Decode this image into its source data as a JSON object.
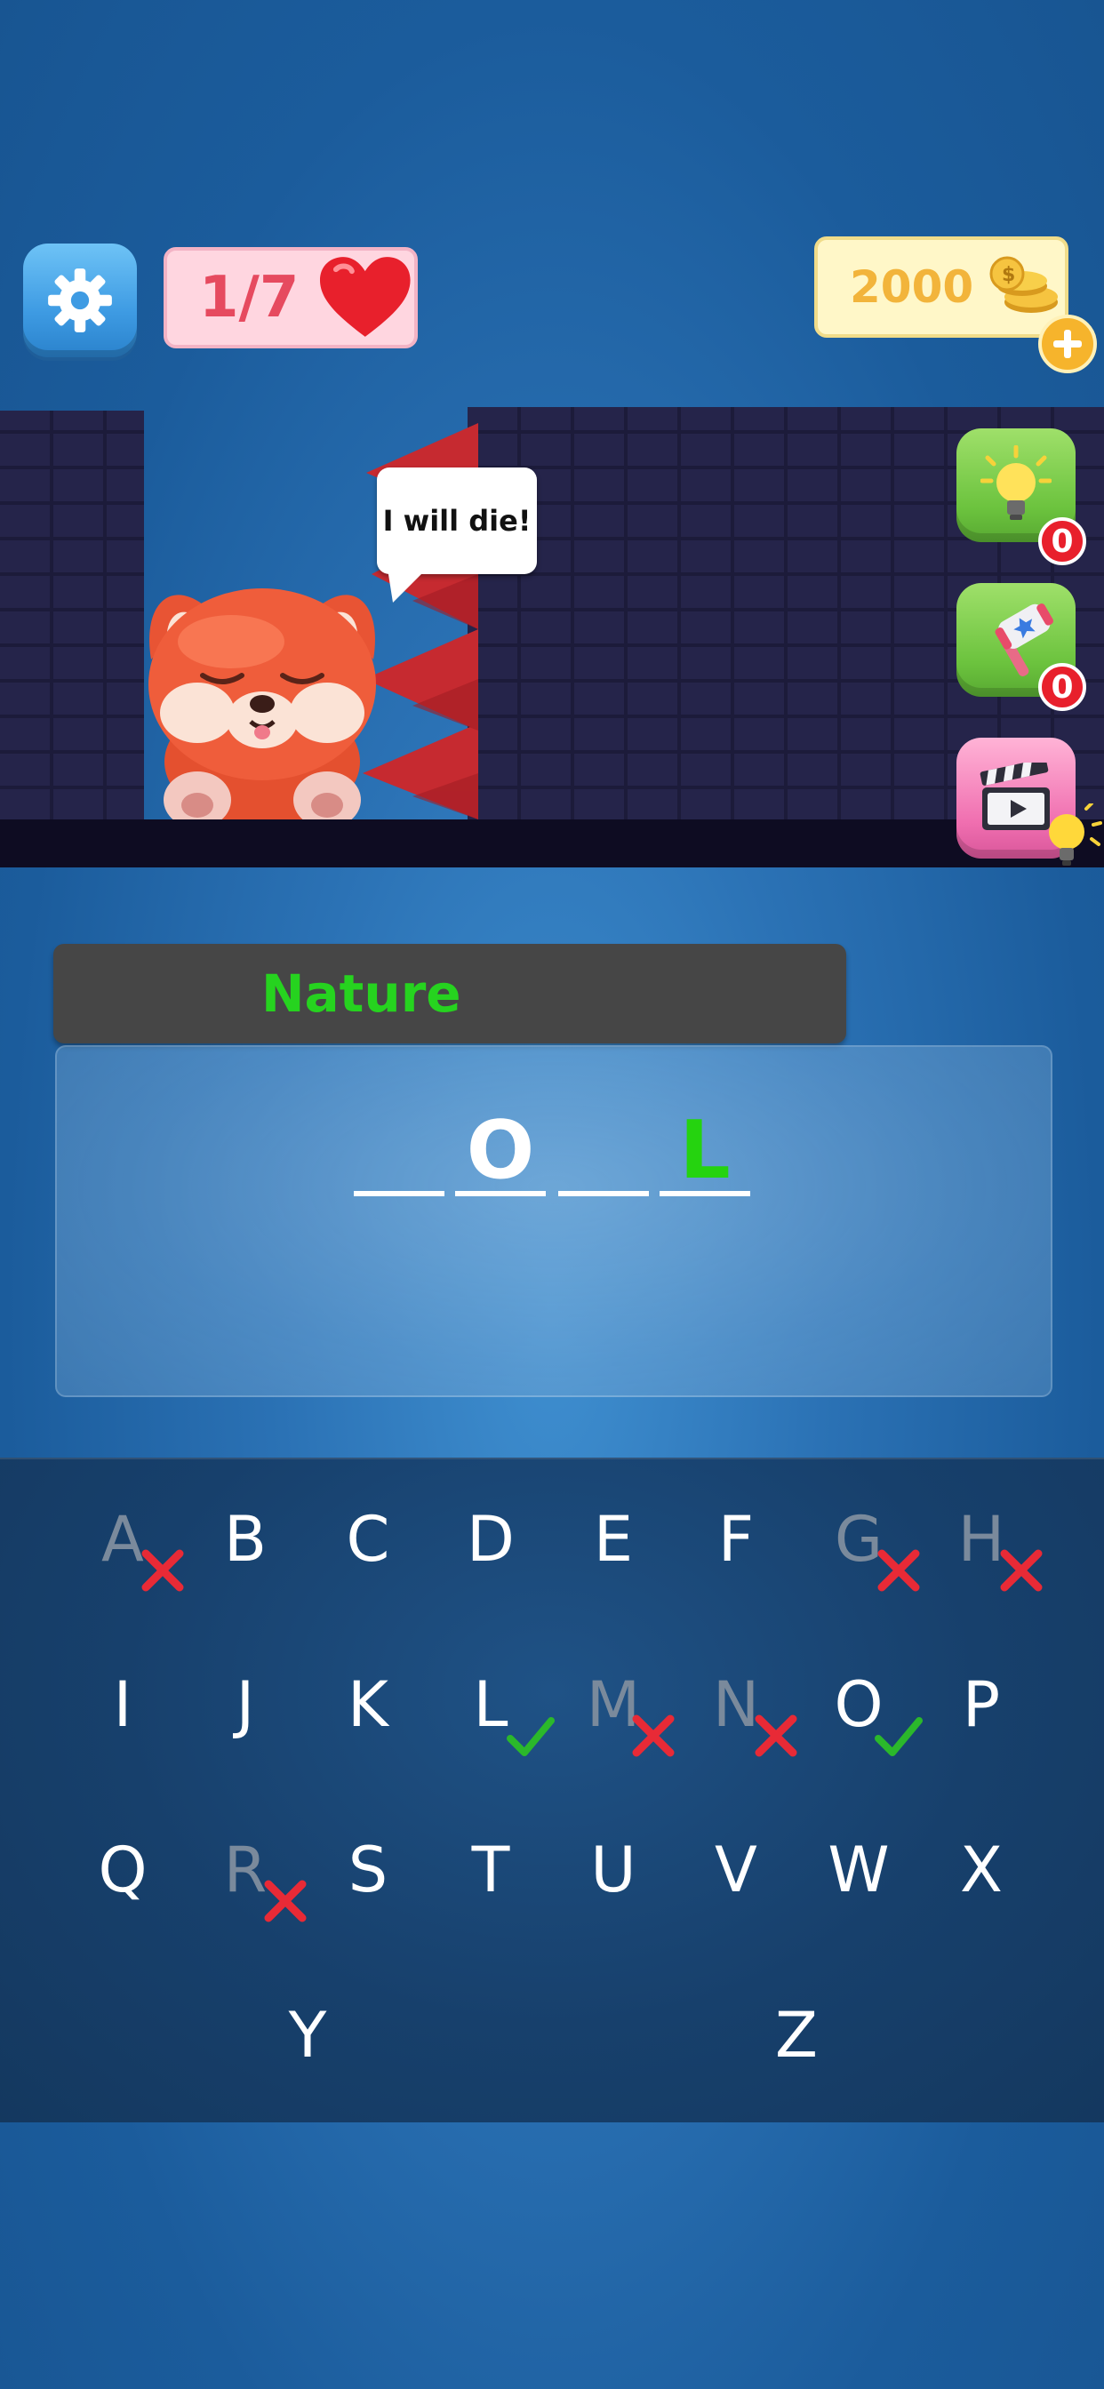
{
  "hud": {
    "lives": "1/7",
    "coins": "2000"
  },
  "scene": {
    "speech": "I will die!"
  },
  "powerups": [
    {
      "name": "hint",
      "count": "0"
    },
    {
      "name": "hammer",
      "count": "0"
    }
  ],
  "word": {
    "category": "Nature",
    "slots": [
      "",
      "O",
      "",
      "L"
    ],
    "slot_colors": [
      "#ffffff",
      "#ffffff",
      "#ffffff",
      "#25d30f"
    ]
  },
  "keyboard": {
    "rows": [
      [
        "A",
        "B",
        "C",
        "D",
        "E",
        "F",
        "G",
        "H"
      ],
      [
        "I",
        "J",
        "K",
        "L",
        "M",
        "N",
        "O",
        "P"
      ],
      [
        "Q",
        "R",
        "S",
        "T",
        "U",
        "V",
        "W",
        "X"
      ],
      [
        "Y",
        "Z"
      ]
    ],
    "wrong": [
      "A",
      "G",
      "H",
      "M",
      "N",
      "R"
    ],
    "correct": [
      "L",
      "O"
    ]
  },
  "colors": {
    "correct": "#2bb82b",
    "wrong": "#e82a36",
    "used_letter": "#7a8a9c",
    "category": "#26d31f"
  }
}
